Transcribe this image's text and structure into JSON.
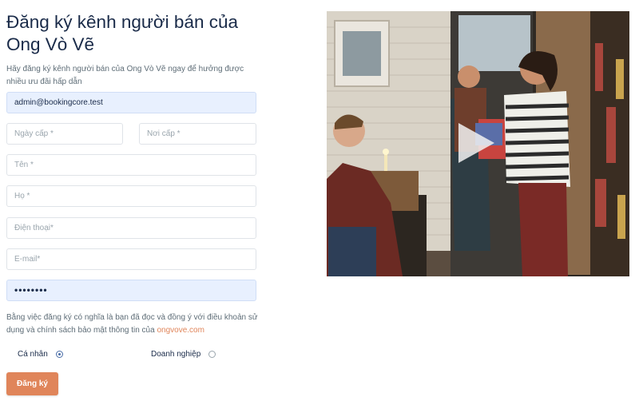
{
  "page": {
    "title": "Đăng ký kênh người bán của Ong Vò Vẽ",
    "subtitle": "Hãy đăng ký kênh người bán của Ong Vò Vẽ ngay để hưởng được nhiều ưu đãi hấp dẫn"
  },
  "form": {
    "email_value": "admin@bookingcore.test",
    "issue_date_placeholder": "Ngày cấp *",
    "issue_place_placeholder": "Nơi cấp *",
    "first_name_placeholder": "Tên *",
    "last_name_placeholder": "Họ *",
    "phone_placeholder": "Điện thoại*",
    "email2_placeholder": "E-mail*",
    "password_mask": "••••••••",
    "terms_text": "Bằng việc đăng ký có nghĩa là bạn đã đọc và đồng ý với điều khoản sử dụng và chính sách bảo mật thông tin của ",
    "terms_link": "ongvove.com",
    "radio_personal": "Cá nhân",
    "radio_business": "Doanh nghiệp",
    "selected_type": "personal",
    "submit_label": "Đăng ký"
  },
  "colors": {
    "accent": "#e0855a",
    "filled_field_bg": "#e8f0fe",
    "title": "#1a2b49"
  },
  "image": {
    "description_icon": "promo-photo"
  }
}
